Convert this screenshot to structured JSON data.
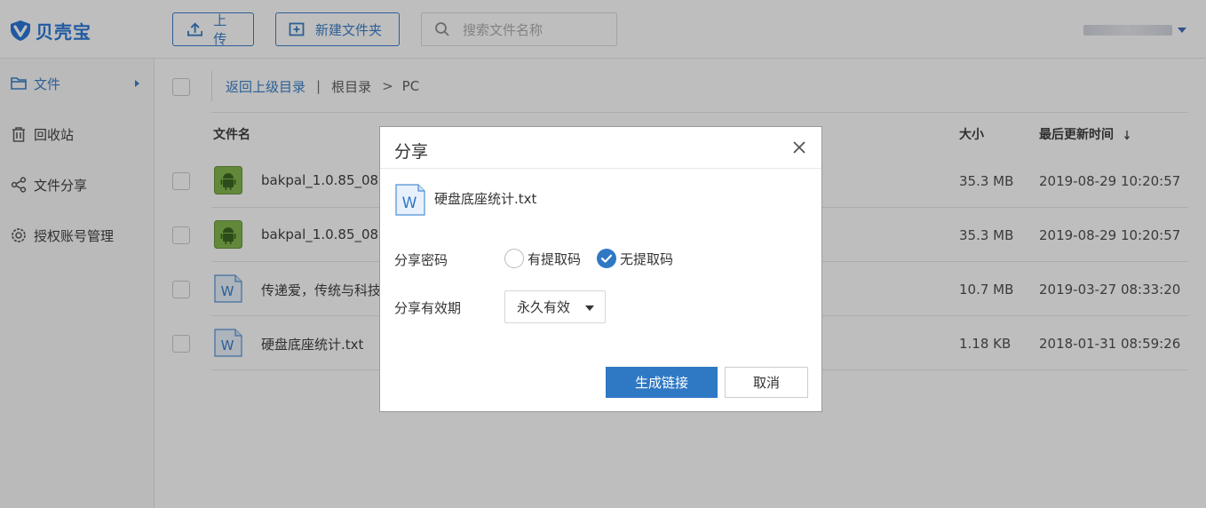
{
  "header": {
    "logo_text": "贝壳宝",
    "upload_label": "上传",
    "new_folder_label": "新建文件夹",
    "search_placeholder": "搜索文件名称"
  },
  "sidebar": {
    "items": [
      {
        "label": "文件",
        "icon": "folder-icon"
      },
      {
        "label": "回收站",
        "icon": "trash-icon"
      },
      {
        "label": "文件分享",
        "icon": "share-icon"
      },
      {
        "label": "授权账号管理",
        "icon": "gear-icon"
      }
    ]
  },
  "breadcrumb": {
    "back": "返回上级目录",
    "separator": "|",
    "root": "根目录",
    "arrow": ">",
    "current": "PC"
  },
  "table": {
    "columns": {
      "name": "文件名",
      "size": "大小",
      "time": "最后更新时间"
    },
    "rows": [
      {
        "name": "bakpal_1.0.85_0828",
        "size": "35.3 MB",
        "time": "2019-08-29 10:20:57",
        "icon": "android-icon"
      },
      {
        "name": "bakpal_1.0.85_0828",
        "size": "35.3 MB",
        "time": "2019-08-29 10:20:57",
        "icon": "android-icon"
      },
      {
        "name": "传递爱，传统与科技",
        "size": "10.7 MB",
        "time": "2019-03-27 08:33:20",
        "icon": "word-doc-icon"
      },
      {
        "name": "硬盘底座统计.txt",
        "size": "1.18 KB",
        "time": "2018-01-31 08:59:26",
        "icon": "word-doc-icon"
      }
    ]
  },
  "dialog": {
    "title": "分享",
    "file_name": "硬盘底座统计.txt",
    "password_label": "分享密码",
    "option_with_code": "有提取码",
    "option_no_code": "无提取码",
    "selected_option": "无提取码",
    "validity_label": "分享有效期",
    "validity_value": "永久有效",
    "generate_label": "生成链接",
    "cancel_label": "取消"
  },
  "colors": {
    "accent": "#2f78c4",
    "android": "#6ab04c"
  }
}
